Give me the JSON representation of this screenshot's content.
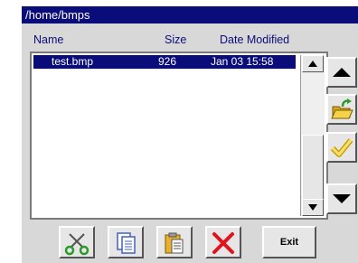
{
  "window": {
    "title": "/home/bmps"
  },
  "columns": {
    "name": "Name",
    "size": "Size",
    "date": "Date Modified"
  },
  "files": [
    {
      "name": "test.bmp",
      "size": "926",
      "date": "Jan 03 15:58",
      "selected": true
    }
  ],
  "side_buttons": [
    {
      "icon": "up-arrow-icon"
    },
    {
      "icon": "open-folder-icon"
    },
    {
      "icon": "checkmark-icon"
    },
    {
      "icon": "down-arrow-icon"
    }
  ],
  "toolbar": {
    "cut_icon": "scissors-icon",
    "copy_icon": "copy-icon",
    "paste_icon": "paste-icon",
    "delete_icon": "delete-x-icon",
    "exit_label": "Exit"
  },
  "colors": {
    "title_bg": "#0a0c7a",
    "selection_bg": "#0a0c7a",
    "panel_bg": "#d8d8d8",
    "delete_red": "#e0141e",
    "folder_yellow": "#f4d24a",
    "arrow_green": "#2a9a2a"
  }
}
